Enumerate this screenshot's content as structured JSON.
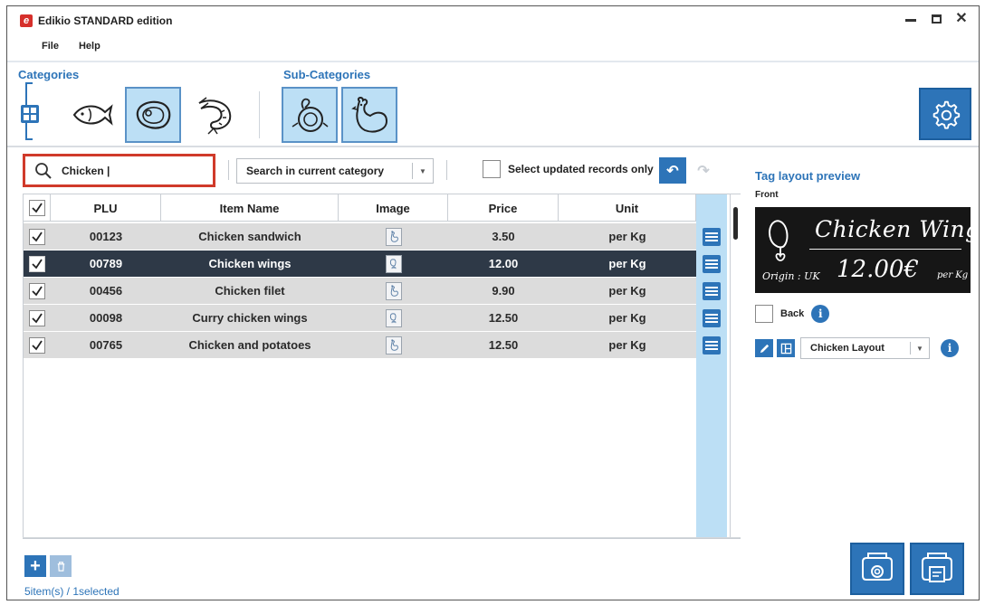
{
  "window": {
    "title": "Edikio STANDARD edition",
    "logo_letter": "e"
  },
  "menu": [
    "File",
    "Help"
  ],
  "toolbar": {
    "categories_label": "Categories",
    "subcategories_label": "Sub-Categories",
    "categories": [
      {
        "name": "all-categories-icon",
        "active": false
      },
      {
        "name": "fish-icon",
        "active": false
      },
      {
        "name": "meat-icon",
        "active": true
      },
      {
        "name": "shrimp-icon",
        "active": false
      }
    ],
    "subcategories": [
      {
        "name": "turkey-icon",
        "active": true
      },
      {
        "name": "chicken-icon",
        "active": true
      }
    ]
  },
  "search": {
    "value": "Chicken |",
    "scope": "Search in current category",
    "updated_only_label": "Select updated records only",
    "updated_only_checked": false
  },
  "table": {
    "columns": [
      "PLU",
      "Item Name",
      "Image",
      "Price",
      "Unit"
    ],
    "rows": [
      {
        "plu": "00123",
        "name": "Chicken sandwich",
        "image": "chicken-icon",
        "price": "3.50",
        "unit": "per Kg",
        "checked": true,
        "selected": false
      },
      {
        "plu": "00789",
        "name": "Chicken wings",
        "image": "drumstick-icon",
        "price": "12.00",
        "unit": "per Kg",
        "checked": true,
        "selected": true
      },
      {
        "plu": "00456",
        "name": "Chicken filet",
        "image": "chicken-icon",
        "price": "9.90",
        "unit": "per Kg",
        "checked": true,
        "selected": false
      },
      {
        "plu": "00098",
        "name": "Curry chicken wings",
        "image": "drumstick-icon",
        "price": "12.50",
        "unit": "per Kg",
        "checked": true,
        "selected": false
      },
      {
        "plu": "00765",
        "name": "Chicken and potatoes",
        "image": "chicken-icon",
        "price": "12.50",
        "unit": "per Kg",
        "checked": true,
        "selected": false
      }
    ]
  },
  "footer": {
    "count_text": "5item(s) / 1selected"
  },
  "preview": {
    "title": "Tag layout preview",
    "front_label": "Front",
    "tag": {
      "name": "Chicken Wings",
      "origin": "Origin : UK",
      "price": "12.00€",
      "unit": "per Kg"
    },
    "back_label": "Back",
    "back_checked": false,
    "layout_name": "Chicken Layout"
  },
  "colors": {
    "accent": "#2d74b8",
    "active_bg": "#bcdff5",
    "search_border": "#d03a2a",
    "selected_row": "#2e3947"
  }
}
